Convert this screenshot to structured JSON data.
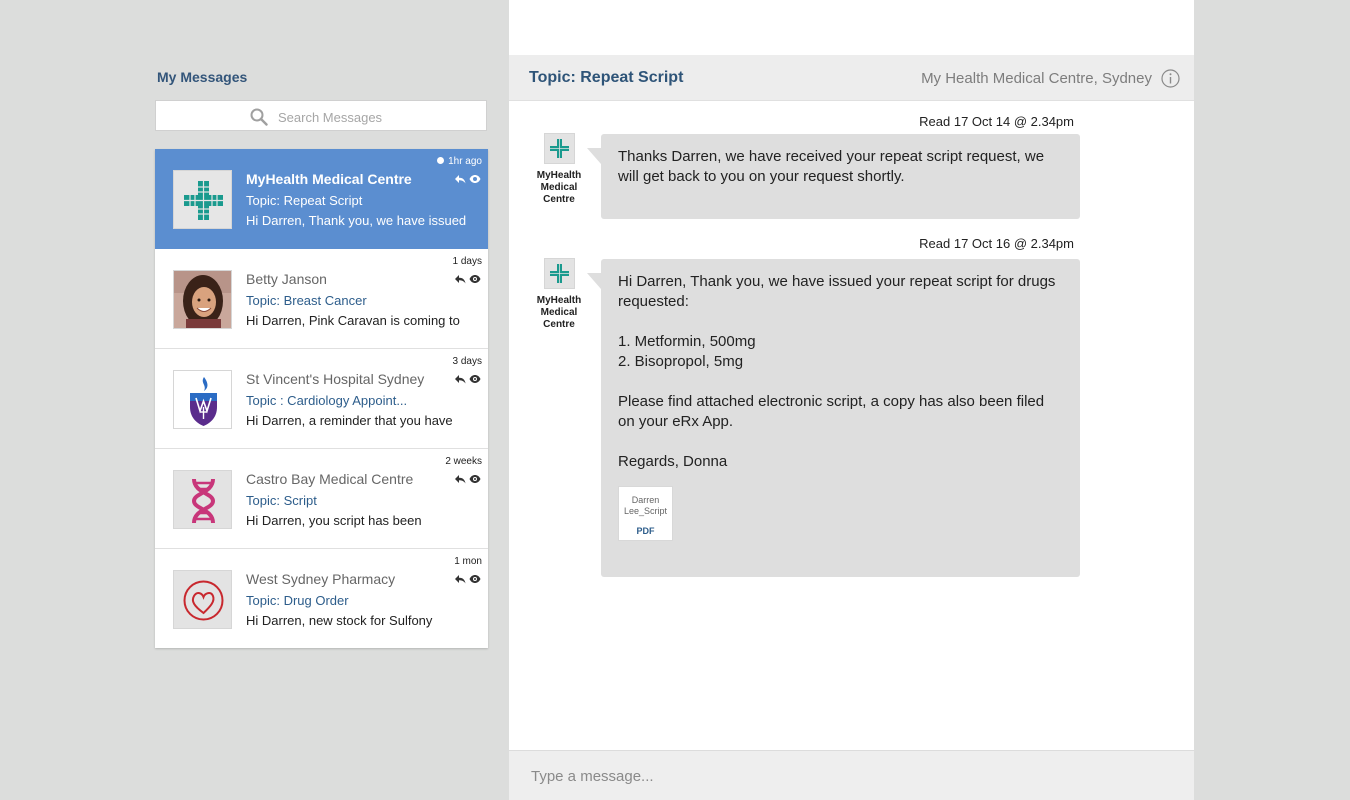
{
  "sidebar": {
    "title": "My Messages",
    "search_placeholder": "Search Messages"
  },
  "conversations": [
    {
      "sender": "MyHealth Medical Centre",
      "topic": "Topic: Repeat Script",
      "preview": "Hi Darren, Thank you, we have issued",
      "time": "1hr ago",
      "unread": true,
      "active": true,
      "avatar": "medical-cross-icon"
    },
    {
      "sender": "Betty Janson",
      "topic": "Topic: Breast Cancer",
      "preview": "Hi Darren, Pink Caravan is coming to",
      "time": "1 days",
      "avatar": "person-photo"
    },
    {
      "sender": "St Vincent's Hospital Sydney",
      "topic": "Topic : Cardiology Appoint...",
      "preview": "Hi Darren, a reminder that you have",
      "time": "3 days",
      "avatar": "hospital-crest-icon"
    },
    {
      "sender": "Castro Bay Medical Centre",
      "topic": "Topic: Script",
      "preview": "Hi Darren, you script has been",
      "time": "2 weeks",
      "avatar": "dna-icon"
    },
    {
      "sender": "West Sydney Pharmacy",
      "topic": "Topic: Drug Order",
      "preview": "Hi Darren, new stock for Sulfony",
      "time": "1 mon",
      "avatar": "heart-icon"
    }
  ],
  "chat": {
    "topic": "Topic: Repeat Script",
    "org": "My Health Medical Centre, Sydney",
    "messages": [
      {
        "read": "Read 17 Oct 14 @ 2.34pm",
        "sender_name": "MyHealth Medical Centre",
        "paragraphs": [
          "Thanks Darren, we have received your repeat script request, we will get back to you on your request shortly."
        ]
      },
      {
        "read": "Read 17 Oct 16 @ 2.34pm",
        "sender_name": "MyHealth Medical Centre",
        "paragraphs": [
          "Hi Darren, Thank you, we have issued your repeat script for drugs requested:",
          "1. Metformin, 500mg",
          "2. Bisopropol, 5mg",
          "Please find attached electronic script, a copy has also been filed on your eRx App.",
          "Regards, Donna"
        ],
        "attachment": {
          "name": "Darren Lee_Script",
          "type": "PDF"
        }
      }
    ],
    "composer_placeholder": "Type a message..."
  },
  "colors": {
    "accent": "#5b8ed0",
    "topic_text": "#2d5d8b",
    "teal_logo": "#1a9a8e"
  }
}
